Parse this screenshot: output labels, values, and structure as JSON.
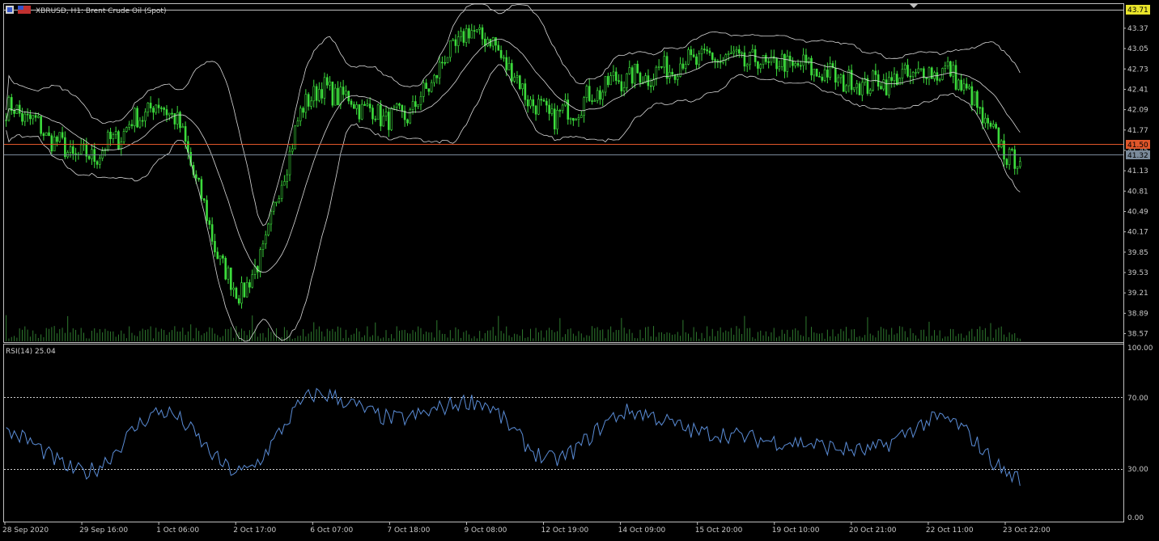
{
  "colors": {
    "background": "#000000",
    "frame": "#bfbfbf",
    "candles": "#3cdc3c",
    "bands": "#d8d8d8",
    "volume": "#2f7a2f",
    "rsi": "#5a8cd6",
    "price_line": "#e0562a",
    "ask_badge": "#e8e32a",
    "bid_badge_red": "#e0562a",
    "bid_badge_gray": "#7a8a9a"
  },
  "header": {
    "symbol_icon": "window-flag-icon",
    "title": "XBRUSD, H1:  Brent Crude Oil (Spot)"
  },
  "price_axis": {
    "labels": [
      "43.37",
      "43.05",
      "42.73",
      "42.41",
      "42.09",
      "41.77",
      "41.45",
      "41.13",
      "40.81",
      "40.49",
      "40.17",
      "39.85",
      "39.53",
      "39.21",
      "38.89",
      "38.57"
    ],
    "ask_badge": "43.71",
    "bid_badge": "41.50",
    "last_badge": "41.32"
  },
  "rsi": {
    "label": "RSI(14) 25.04",
    "levels": [
      "100.00",
      "70.00",
      "30.00",
      "0.00"
    ]
  },
  "time_axis": {
    "labels": [
      "28 Sep 2020",
      "29 Sep 16:00",
      "1 Oct 06:00",
      "2 Oct 17:00",
      "6 Oct 07:00",
      "7 Oct 18:00",
      "9 Oct 08:00",
      "12 Oct 19:00",
      "14 Oct 09:00",
      "15 Oct 20:00",
      "19 Oct 10:00",
      "20 Oct 21:00",
      "22 Oct 11:00",
      "23 Oct 22:00"
    ]
  },
  "chart_data": {
    "type": "line",
    "symbol": "XBRUSD",
    "timeframe": "H1",
    "ylim": [
      38.45,
      43.75
    ],
    "rsi_ylim": [
      0,
      100
    ],
    "x": [
      "28 Sep 2020",
      "29 Sep 16:00",
      "1 Oct 06:00",
      "2 Oct 17:00",
      "6 Oct 07:00",
      "7 Oct 18:00",
      "9 Oct 08:00",
      "12 Oct 19:00",
      "14 Oct 09:00",
      "15 Oct 20:00",
      "19 Oct 10:00",
      "20 Oct 21:00",
      "22 Oct 11:00",
      "23 Oct 22:00"
    ],
    "series": [
      {
        "values": [
          42.1,
          41.35,
          42.15,
          39.25,
          42.4,
          41.95,
          43.3,
          42.0,
          42.6,
          42.9,
          42.8,
          42.5,
          42.7,
          41.3
        ]
      },
      {
        "values": [
          50,
          28,
          62,
          28,
          72,
          58,
          68,
          35,
          62,
          50,
          45,
          40,
          58,
          25
        ]
      }
    ]
  }
}
